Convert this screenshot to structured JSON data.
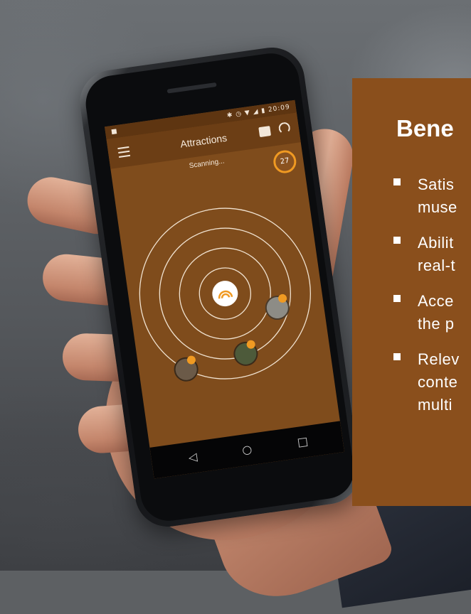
{
  "phone_app": {
    "statusbar": {
      "time": "20:09",
      "icons": [
        "bluetooth-icon",
        "alarm-icon",
        "wifi-icon",
        "signal-icon",
        "battery-icon"
      ]
    },
    "title": "Attractions",
    "scan_status": "Scanning...",
    "attraction_count": "27",
    "nav_buttons": [
      "back-icon",
      "home-icon",
      "recent-apps-icon"
    ],
    "colors": {
      "screen": "#7f4c1c",
      "appbar": "#6c3e15",
      "accent": "#f09a22"
    }
  },
  "benefits_panel": {
    "title": "Bene",
    "items": [
      {
        "lines": [
          "Satis",
          "muse"
        ]
      },
      {
        "lines": [
          "Abilit",
          "real-t"
        ]
      },
      {
        "lines": [
          "Acce",
          "the p"
        ]
      },
      {
        "lines": [
          "Relev",
          "conte",
          "multi"
        ]
      }
    ],
    "colors": {
      "background": "#8a4f1c",
      "text": "#ffffff"
    }
  }
}
